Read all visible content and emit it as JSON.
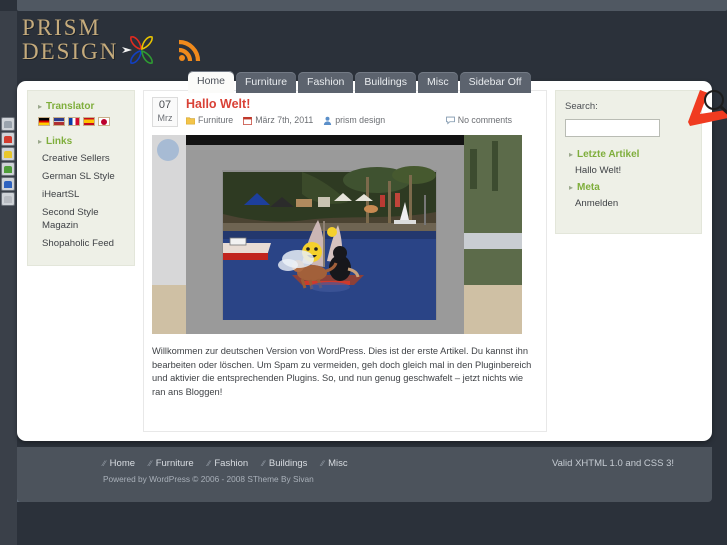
{
  "site": {
    "logo_line1": "PRISM",
    "logo_line2": "DESIGN",
    "logo_icon": "flower-pinwheel-logo",
    "rss_icon": "rss-feed-icon"
  },
  "nav": {
    "tabs": [
      {
        "label": "Home",
        "active": true
      },
      {
        "label": "Furniture",
        "active": false
      },
      {
        "label": "Fashion",
        "active": false
      },
      {
        "label": "Buildings",
        "active": false
      },
      {
        "label": "Misc",
        "active": false
      },
      {
        "label": "Sidebar Off",
        "active": false
      }
    ]
  },
  "sidebar_left": {
    "translator": {
      "title": "Translator",
      "languages": [
        "German",
        "English",
        "French",
        "Spanish",
        "Japanese"
      ]
    },
    "links": {
      "title": "Links",
      "items": [
        "Creative Sellers",
        "German SL Style",
        "iHeartSL",
        "Second Style Magazin",
        "Shopaholic Feed"
      ]
    }
  },
  "post": {
    "date_day": "07",
    "date_month": "Mrz",
    "title": "Hallo Welt!",
    "category": "Furniture",
    "date_full": "März 7th, 2011",
    "author": "prism design",
    "comments": "No comments",
    "image_alt": "Second Life beach scene with sailboat, avatar and dog on blue water",
    "body": "Willkommen zur deutschen Version von WordPress. Dies ist der erste Artikel. Du kannst ihn bearbeiten oder löschen. Um Spam zu vermeiden, geh doch gleich mal in den Pluginbereich und aktivier die entsprechenden Plugins. So, und nun genug geschwafelt – jetzt nichts wie ran ans Bloggen!"
  },
  "sidebar_right": {
    "search_label": "Search:",
    "search_value": "",
    "search_placeholder": "",
    "recent_title": "Letzte Artikel",
    "recent_items": [
      "Hallo Welt!"
    ],
    "meta_title": "Meta",
    "meta_items": [
      "Anmelden"
    ],
    "annotation_icon": "search-magnifier-annotation"
  },
  "footer": {
    "nav": [
      "Home",
      "Furniture",
      "Fashion",
      "Buildings",
      "Misc"
    ],
    "valid": "Valid XHTML 1.0 and CSS 3!",
    "credit": "Powered by WordPress © 2006 - 2008 STheme By Sivan"
  },
  "browser": {
    "edge_icons": [
      "home-icon",
      "red-shield-icon",
      "yellow-shield-icon",
      "green-shield-icon",
      "blue-shield-icon",
      "gray-page-icon"
    ]
  },
  "colors": {
    "page_bg": "#2b313a",
    "chrome": "#505862",
    "panel_bg": "#ffffff",
    "widget_bg": "#eef0e7",
    "accent_green": "#7fae3c",
    "accent_red": "#d94136",
    "logo_gold": "#c5ab7c",
    "footer_bg": "#4c535c",
    "annotation_red": "#f03b20"
  }
}
